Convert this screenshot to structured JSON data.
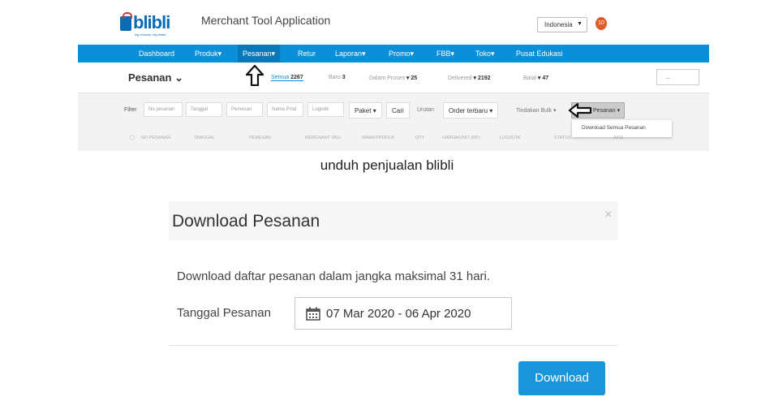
{
  "app": {
    "logo_text": "blibli",
    "logo_subtext": "big choices. big deals.",
    "title": "Merchant Tool Application",
    "language": "Indonesia",
    "notification_count": "10"
  },
  "nav": [
    {
      "label": "Dashboard"
    },
    {
      "label": "Produk▾"
    },
    {
      "label": "Pesanan▾"
    },
    {
      "label": "Retur"
    },
    {
      "label": "Laporan▾"
    },
    {
      "label": "Promo▾"
    },
    {
      "label": "FBB▾"
    },
    {
      "label": "Toko▾"
    },
    {
      "label": "Pusat Edukasi"
    }
  ],
  "orders": {
    "title": "Pesanan",
    "statuses": [
      {
        "label": "Semua",
        "count": "2267"
      },
      {
        "label": "Baru",
        "count": "3"
      },
      {
        "label": "Dalam Proses",
        "count": "25"
      },
      {
        "label": "Delivered",
        "count": "2192"
      },
      {
        "label": "Batal",
        "count": "47"
      }
    ],
    "search_placeholder": "..."
  },
  "filter": {
    "label": "Filter",
    "inputs": [
      "No pesanan",
      "Tanggal",
      "Pemesan",
      "Nama Prod",
      "Logistik"
    ],
    "paket": "Paket",
    "cari": "Cari",
    "urutan_label": "Urutan",
    "urutan_value": "Order terbaru",
    "tindakan": "Tindakan Bulk",
    "daftar": "Daftar Pesanan",
    "menu_item": "Download Semua Pesanan"
  },
  "table_headers": [
    "NO PESANAN",
    "TANGGAL",
    "PEMESAN",
    "MERCHANT SKU",
    "NAMA PRODUK",
    "QTY",
    "HARGA/UNIT (RP)",
    "LOGISTIK",
    "STATUS",
    "AKSI"
  ],
  "caption": "unduh penjualan blibli",
  "modal": {
    "title": "Download Pesanan",
    "close": "×",
    "description": "Download daftar pesanan dalam jangka maksimal 31 hari.",
    "date_label": "Tanggal Pesanan",
    "date_value": "07 Mar 2020 - 06 Apr 2020",
    "download_button": "Download"
  }
}
